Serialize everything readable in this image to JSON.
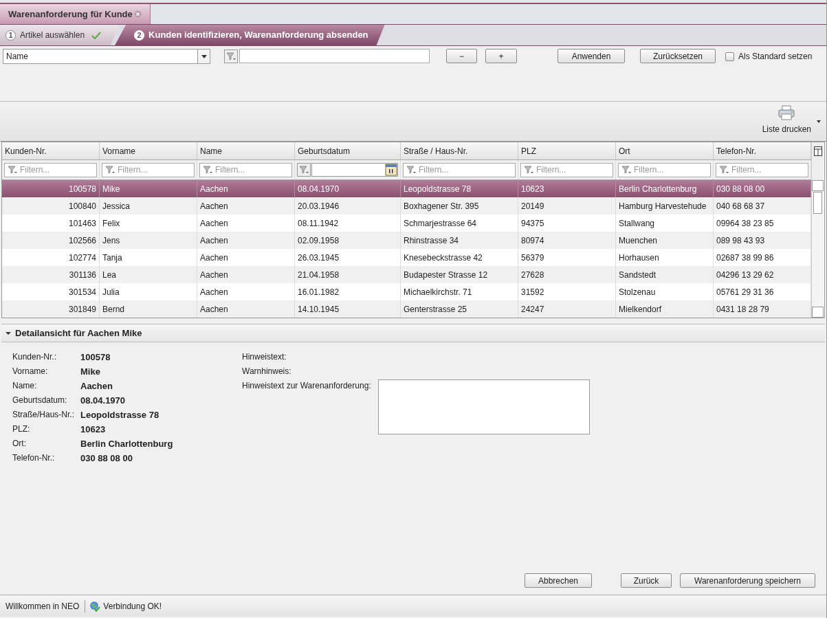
{
  "document_tab": {
    "title": "Warenanforderung für Kunde"
  },
  "steps": [
    {
      "number": "1",
      "label": "Artikel auswählen",
      "done": true,
      "selected": false
    },
    {
      "number": "2",
      "label": "Kunden identifizieren, Warenanforderung absenden",
      "done": false,
      "selected": true
    }
  ],
  "filter_bar": {
    "field": "Name",
    "buttons": [
      "−",
      "+"
    ],
    "apply": "Anwenden",
    "reset": "Zurücksetzen",
    "default_checkbox": {
      "label": "Als Standard setzen",
      "checked": false
    }
  },
  "toolbar": {
    "print": "Liste drucken"
  },
  "table": {
    "columns": [
      {
        "label": "Kunden-Nr.",
        "kind": "text",
        "placeholder": "Filtern..."
      },
      {
        "label": "Vorname",
        "kind": "text",
        "placeholder": "Filtern..."
      },
      {
        "label": "Name",
        "kind": "text",
        "placeholder": "Filtern..."
      },
      {
        "label": "Geburtsdatum",
        "kind": "date"
      },
      {
        "label": "Straße / Haus-Nr.",
        "kind": "text",
        "placeholder": "Filtern..."
      },
      {
        "label": "PLZ",
        "kind": "text",
        "placeholder": "Filtern..."
      },
      {
        "label": "Ort",
        "kind": "text",
        "placeholder": "Filtern..."
      },
      {
        "label": "Telefon-Nr.",
        "kind": "text",
        "placeholder": "Filtern..."
      }
    ],
    "rows": [
      {
        "selected": true,
        "cells": [
          "100578",
          "Mike",
          "Aachen",
          "08.04.1970",
          "Leopoldstrasse 78",
          "10623",
          "Berlin Charlottenburg",
          "030 88 08 00"
        ]
      },
      {
        "selected": false,
        "cells": [
          "100840",
          "Jessica",
          "Aachen",
          "20.03.1946",
          "Boxhagener Str. 395",
          "20149",
          "Hamburg Harvestehude",
          "040 68 68 37"
        ]
      },
      {
        "selected": false,
        "cells": [
          "101463",
          "Felix",
          "Aachen",
          "08.11.1942",
          "Schmarjestrasse 64",
          "94375",
          "Stallwang",
          "09964 38 23 85"
        ]
      },
      {
        "selected": false,
        "cells": [
          "102566",
          "Jens",
          "Aachen",
          "02.09.1958",
          "Rhinstrasse 34",
          "80974",
          "Muenchen",
          "089 98 43 93"
        ]
      },
      {
        "selected": false,
        "cells": [
          "102774",
          "Tanja",
          "Aachen",
          "26.03.1945",
          "Knesebeckstrasse 42",
          "56379",
          "Horhausen",
          "02687 38 99 86"
        ]
      },
      {
        "selected": false,
        "cells": [
          "301136",
          "Lea",
          "Aachen",
          "21.04.1958",
          "Budapester Strasse 12",
          "27628",
          "Sandstedt",
          "04296 13 29 62"
        ]
      },
      {
        "selected": false,
        "cells": [
          "301534",
          "Julia",
          "Aachen",
          "16.01.1982",
          "Michaelkirchstr. 71",
          "31592",
          "Stolzenau",
          "05761 29 31 36"
        ]
      },
      {
        "selected": false,
        "cells": [
          "301849",
          "Bernd",
          "Aachen",
          "14.10.1945",
          "Genterstrasse 25",
          "24247",
          "Mielkendorf",
          "0431 18 28 79"
        ]
      }
    ]
  },
  "detail": {
    "title": "Detailansicht für Aachen Mike",
    "expanded": true,
    "fields": [
      {
        "label": "Kunden-Nr.:",
        "value": "100578"
      },
      {
        "label": "Vorname:",
        "value": "Mike"
      },
      {
        "label": "Name:",
        "value": "Aachen"
      },
      {
        "label": "Geburtsdatum:",
        "value": "08.04.1970"
      },
      {
        "label": "Straße/Haus-Nr.:",
        "value": "Leopoldstrasse 78"
      },
      {
        "label": "PLZ:",
        "value": "10623"
      },
      {
        "label": "Ort:",
        "value": "Berlin Charlottenburg"
      },
      {
        "label": "Telefon-Nr.:",
        "value": "030 88 08 00"
      }
    ],
    "notes": [
      "Hinweistext:",
      "Warnhinweis:",
      "Hinweistext zur Warenanforderung:"
    ]
  },
  "actions": [
    "Abbrechen",
    "Zurück",
    "Warenanforderung speichern"
  ],
  "status_bar": [
    "Willkommen in NEO",
    "Verbindung OK!"
  ]
}
